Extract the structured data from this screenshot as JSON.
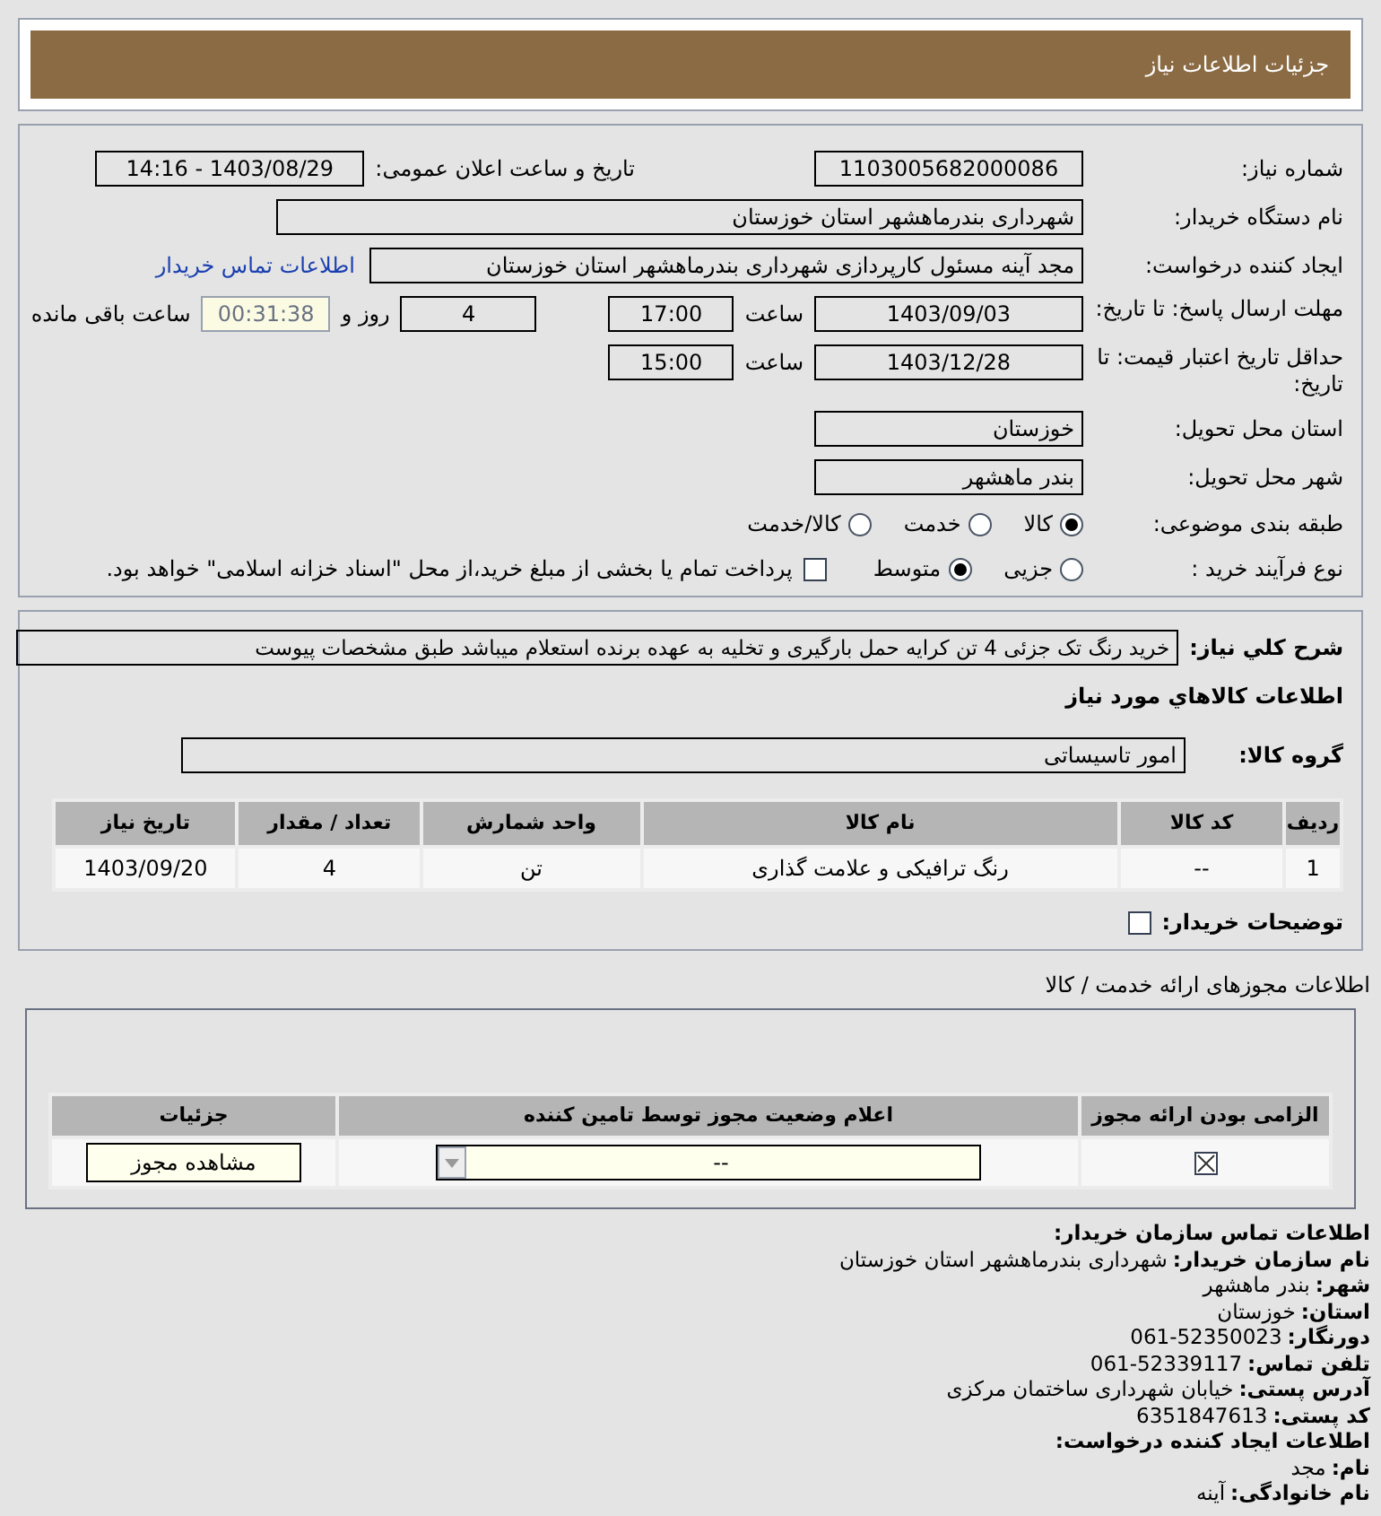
{
  "header": {
    "title": "جزئیات اطلاعات نیاز"
  },
  "need": {
    "number_label": "شماره نیاز:",
    "number": "1103005682000086",
    "announce_label": "تاریخ و ساعت اعلان عمومی:",
    "announce": "1403/08/29 - 14:16",
    "buyer_label": "نام دستگاه خریدار:",
    "buyer": "شهرداری بندرماهشهر استان خوزستان",
    "creator_label": "ایجاد کننده درخواست:",
    "creator": "مجد آینه مسئول کارپردازی شهرداری بندرماهشهر استان خوزستان",
    "contact_link": "اطلاعات تماس خریدار",
    "deadline_label": "مهلت ارسال پاسخ: تا تاریخ:",
    "deadline_date": "1403/09/03",
    "time_label": "ساعت",
    "deadline_time": "17:00",
    "days": "4",
    "days_label": "روز و",
    "remaining": "00:31:38",
    "remaining_label": "ساعت باقی مانده",
    "validity_label": "حداقل تاریخ اعتبار قیمت: تا تاریخ:",
    "validity_date": "1403/12/28",
    "validity_time_label": "ساعت",
    "validity_time": "15:00",
    "province_label": "استان محل تحویل:",
    "province": "خوزستان",
    "city_label": "شهر محل تحویل:",
    "city": "بندر ماهشهر",
    "category_label": "طبقه بندی موضوعی:",
    "categories": [
      {
        "label": "کالا",
        "selected": true
      },
      {
        "label": "خدمت",
        "selected": false
      },
      {
        "label": "کالا/خدمت",
        "selected": false
      }
    ],
    "purchase_label": "نوع فرآیند خرید :",
    "purchase_types": [
      {
        "label": "جزیی",
        "selected": false
      },
      {
        "label": "متوسط",
        "selected": true
      }
    ],
    "payment": {
      "label": "پرداخت تمام یا بخشی از مبلغ خرید،از محل \"اسناد خزانه اسلامی\" خواهد بود.",
      "checked": false
    }
  },
  "items": {
    "description_label": "شرح کلي نیاز:",
    "description": "خرید رنگ تک جزئی 4 تن کرایه حمل بارگیری و تخلیه به عهده برنده استعلام میباشد طبق مشخصات پیوست",
    "section_title": "اطلاعات کالاهاي مورد نیاز",
    "group_label": "گروه کالا:",
    "group": "امور تاسیساتی",
    "columns": [
      "ردیف",
      "کد کالا",
      "نام کالا",
      "واحد شمارش",
      "تعداد / مقدار",
      "تاریخ نیاز"
    ],
    "rows": [
      [
        "1",
        "--",
        "رنگ ترافیکی و علامت گذاری",
        "تن",
        "4",
        "1403/09/20"
      ]
    ],
    "notes_label": "توضیحات خریدار:",
    "notes_checked": false
  },
  "licenses": {
    "title": "اطلاعات مجوزهای ارائه خدمت / کالا",
    "columns": [
      "الزامی بودن ارائه مجوز",
      "اعلام وضعیت مجوز توسط تامین کننده",
      "جزئیات"
    ],
    "rows": [
      {
        "required": true,
        "status": "--",
        "button": "مشاهده مجوز"
      }
    ]
  },
  "contact": [
    {
      "kind": "heading",
      "label": "اطلاعات تماس سازمان خریدار:"
    },
    {
      "kind": "field",
      "label": "نام سازمان خریدار:",
      "value": "شهرداری بندرماهشهر استان خوزستان"
    },
    {
      "kind": "field",
      "label": "شهر:",
      "value": "بندر ماهشهر"
    },
    {
      "kind": "field",
      "label": "استان:",
      "value": "خوزستان"
    },
    {
      "kind": "field",
      "label": "دورنگار:",
      "value": "061-52350023"
    },
    {
      "kind": "field",
      "label": "تلفن تماس:",
      "value": "061-52339117"
    },
    {
      "kind": "field",
      "label": "آدرس پستی:",
      "value": "خیابان شهرداری ساختمان مرکزی"
    },
    {
      "kind": "field",
      "label": "کد پستی:",
      "value": "6351847613"
    },
    {
      "kind": "heading",
      "label": "اطلاعات ایجاد کننده درخواست:"
    },
    {
      "kind": "field",
      "label": "نام:",
      "value": "مجد"
    },
    {
      "kind": "field",
      "label": "نام خانوادگی:",
      "value": "آینه"
    }
  ]
}
